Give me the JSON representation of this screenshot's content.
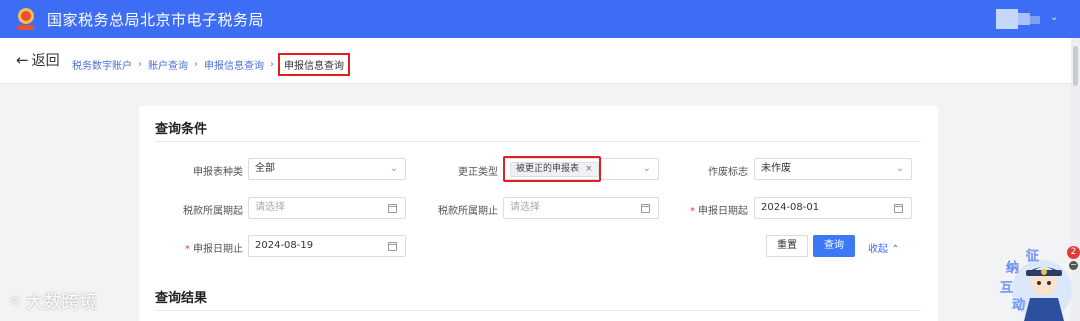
{
  "header": {
    "title": "国家税务总局北京市电子税务局",
    "user_menu_icon": "chevron-down-icon",
    "brand_color": "#3d6df5"
  },
  "nav": {
    "back_label": "返回",
    "breadcrumbs": [
      "税务数字账户",
      "账户查询",
      "申报信息查询",
      "申报信息查询"
    ]
  },
  "conditions": {
    "section_title": "查询条件",
    "report_type": {
      "label": "申报表种类",
      "value": "全部"
    },
    "correction_type": {
      "label": "更正类型",
      "tag": "被更正的申报表"
    },
    "void_flag": {
      "label": "作废标志",
      "value": "未作废"
    },
    "tax_period_start": {
      "label": "税款所属期起",
      "placeholder": "请选择"
    },
    "tax_period_end": {
      "label": "税款所属期止",
      "placeholder": "请选择"
    },
    "declare_date_start": {
      "label": "申报日期起",
      "value": "2024-08-01"
    },
    "declare_date_end": {
      "label": "申报日期止",
      "value": "2024-08-19"
    },
    "reset_label": "重置",
    "query_label": "查询",
    "collapse_label": "收起"
  },
  "results": {
    "section_title": "查询结果"
  },
  "overlay": {
    "watermark": "大数跨境",
    "mascot_text": [
      "征",
      "纳",
      "互",
      "动"
    ],
    "notification_count": "2"
  }
}
